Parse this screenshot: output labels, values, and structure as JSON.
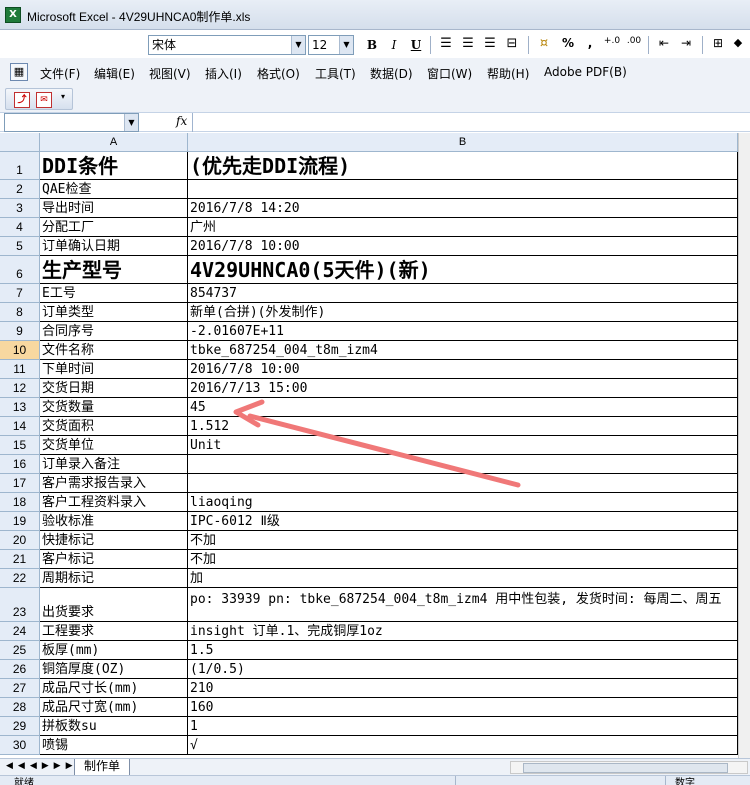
{
  "window": {
    "title": "Microsoft Excel - 4V29UHNCA0制作单.xls",
    "app_icon_letter": "X"
  },
  "format_toolbar": {
    "font_name": "宋体",
    "font_size": "12",
    "bold": "B",
    "italic": "I",
    "underline": "U",
    "percent": "%",
    "comma": ","
  },
  "menu": {
    "items": [
      "文件(F)",
      "编辑(E)",
      "视图(V)",
      "插入(I)",
      "格式(O)",
      "工具(T)",
      "数据(D)",
      "窗口(W)",
      "帮助(H)",
      "Adobe PDF(B)"
    ]
  },
  "formula_bar": {
    "name_box": "",
    "fx": "fx",
    "content": ""
  },
  "columns": [
    {
      "label": "A"
    },
    {
      "label": "B"
    }
  ],
  "rows": [
    {
      "num": "1",
      "a": "DDI条件",
      "b": "(优先走DDI流程)"
    },
    {
      "num": "2",
      "a": "QAE检查",
      "b": ""
    },
    {
      "num": "3",
      "a": "导出时间",
      "b": "2016/7/8 14:20"
    },
    {
      "num": "4",
      "a": "分配工厂",
      "b": "广州"
    },
    {
      "num": "5",
      "a": "订单确认日期",
      "b": "2016/7/8 10:00"
    },
    {
      "num": "6",
      "a": "生产型号",
      "b": "4V29UHNCA0(5天件)(新)"
    },
    {
      "num": "7",
      "a": "E工号",
      "b": "854737"
    },
    {
      "num": "8",
      "a": "订单类型",
      "b": "新单(合拼)(外发制作)"
    },
    {
      "num": "9",
      "a": "合同序号",
      "b": "-2.01607E+11"
    },
    {
      "num": "10",
      "a": "文件名称",
      "b": "tbke_687254_004_t8m_izm4"
    },
    {
      "num": "11",
      "a": "下单时间",
      "b": "2016/7/8 10:00"
    },
    {
      "num": "12",
      "a": "交货日期",
      "b": "2016/7/13 15:00"
    },
    {
      "num": "13",
      "a": "交货数量",
      "b": "45"
    },
    {
      "num": "14",
      "a": "交货面积",
      "b": "1.512"
    },
    {
      "num": "15",
      "a": "交货单位",
      "b": "Unit"
    },
    {
      "num": "16",
      "a": "订单录入备注",
      "b": ""
    },
    {
      "num": "17",
      "a": "客户需求报告录入",
      "b": ""
    },
    {
      "num": "18",
      "a": "客户工程资料录入",
      "b": "liaoqing"
    },
    {
      "num": "19",
      "a": "验收标准",
      "b": "IPC-6012 Ⅱ级"
    },
    {
      "num": "20",
      "a": "快捷标记",
      "b": "不加"
    },
    {
      "num": "21",
      "a": "客户标记",
      "b": "不加"
    },
    {
      "num": "22",
      "a": "周期标记",
      "b": "加"
    },
    {
      "num": "23",
      "a": "出货要求",
      "b": "po: 33939 pn: tbke_687254_004_t8m_izm4 用中性包装, 发货时间: 每周二、周五"
    },
    {
      "num": "24",
      "a": "工程要求",
      "b": "insight 订单.1、完成铜厚1oz"
    },
    {
      "num": "25",
      "a": "板厚(mm)",
      "b": "1.5"
    },
    {
      "num": "26",
      "a": "铜箔厚度(OZ)",
      "b": "(1/0.5)"
    },
    {
      "num": "27",
      "a": "成品尺寸长(mm)",
      "b": "210"
    },
    {
      "num": "28",
      "a": "成品尺寸宽(mm)",
      "b": "160"
    },
    {
      "num": "29",
      "a": "拼板数su",
      "b": "1"
    },
    {
      "num": "30",
      "a": "喷锡",
      "b": "√"
    }
  ],
  "sheet_tabs": [
    "制作单"
  ],
  "status": {
    "left": "就绪",
    "right": "数字"
  },
  "colors": {
    "annotation_arrow": "#f07878",
    "selected_row_header": "#f8d8a0",
    "header_bg": "#e4ecf7"
  }
}
